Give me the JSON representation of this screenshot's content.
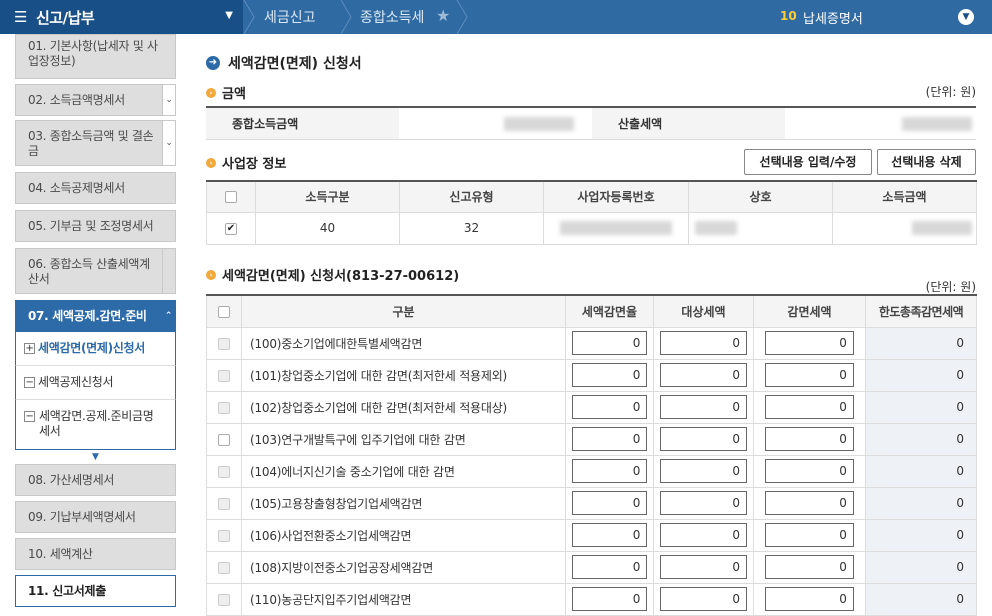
{
  "topbar": {
    "menu_title": "신고/납부",
    "breadcrumb": [
      "세금신고",
      "종합소득세"
    ],
    "doc_count": "10",
    "doc_label": "납세증명서"
  },
  "sidebar": {
    "items": [
      {
        "label": "01. 기본사항(납세자 및 사업장정보)"
      },
      {
        "label": "02. 소득금액명세서"
      },
      {
        "label": "03. 종합소득금액 및 결손금"
      },
      {
        "label": "04. 소득공제명세서"
      },
      {
        "label": "05. 기부금 및 조정명세서"
      },
      {
        "label": "06. 종합소득 산출세액계산서"
      },
      {
        "label": "07. 세액공제.감면.준비"
      },
      {
        "label": "08. 가산세명세서"
      },
      {
        "label": "09. 기납부세액명세서"
      },
      {
        "label": "10. 세액계산"
      },
      {
        "label": "11. 신고서제출"
      }
    ],
    "subitems": [
      {
        "label": "세액감면(면제)신청서"
      },
      {
        "label": "세액공제신청서"
      },
      {
        "label": "세액감면.공제.준비금명세서"
      }
    ]
  },
  "main": {
    "title": "세액감면(면제) 신청서",
    "amount": {
      "heading": "금액",
      "unit": "(단위: 원)",
      "income_label": "종합소득금액",
      "tax_label": "산출세액"
    },
    "business": {
      "heading": "사업장 정보",
      "btn_edit": "선택내용 입력/수정",
      "btn_delete": "선택내용 삭제",
      "columns": [
        "소득구분",
        "신고유형",
        "사업자등록번호",
        "상호",
        "소득금액"
      ],
      "row": {
        "income_type": "40",
        "report_type": "32"
      }
    },
    "reduction": {
      "heading": "세액감면(면제) 신청서(813-27-00612)",
      "unit": "(단위: 원)",
      "columns": [
        "구분",
        "세액감면율",
        "대상세액",
        "감면세액",
        "한도총족감면세액"
      ],
      "rows": [
        {
          "name": "(100)중소기업에대한특별세액감면",
          "rate": "0",
          "target": "0",
          "reduced": "0",
          "limit": "0"
        },
        {
          "name": "(101)창업중소기업에 대한 감면(최저한세 적용제외)",
          "rate": "0",
          "target": "0",
          "reduced": "0",
          "limit": "0"
        },
        {
          "name": "(102)창업중소기업에 대한 감면(최저한세 적용대상)",
          "rate": "0",
          "target": "0",
          "reduced": "0",
          "limit": "0"
        },
        {
          "name": "(103)연구개발특구에 입주기업에 대한 감면",
          "rate": "0",
          "target": "0",
          "reduced": "0",
          "limit": "0"
        },
        {
          "name": "(104)에너지신기술 중소기업에 대한 감면",
          "rate": "0",
          "target": "0",
          "reduced": "0",
          "limit": "0"
        },
        {
          "name": "(105)고용창출형창업기업세액감면",
          "rate": "0",
          "target": "0",
          "reduced": "0",
          "limit": "0"
        },
        {
          "name": "(106)사업전환중소기업세액감면",
          "rate": "0",
          "target": "0",
          "reduced": "0",
          "limit": "0"
        },
        {
          "name": "(108)지방이전중소기업공장세액감면",
          "rate": "0",
          "target": "0",
          "reduced": "0",
          "limit": "0"
        },
        {
          "name": "(110)농공단지입주기업세액감면",
          "rate": "0",
          "target": "0",
          "reduced": "0",
          "limit": "0"
        }
      ]
    }
  }
}
